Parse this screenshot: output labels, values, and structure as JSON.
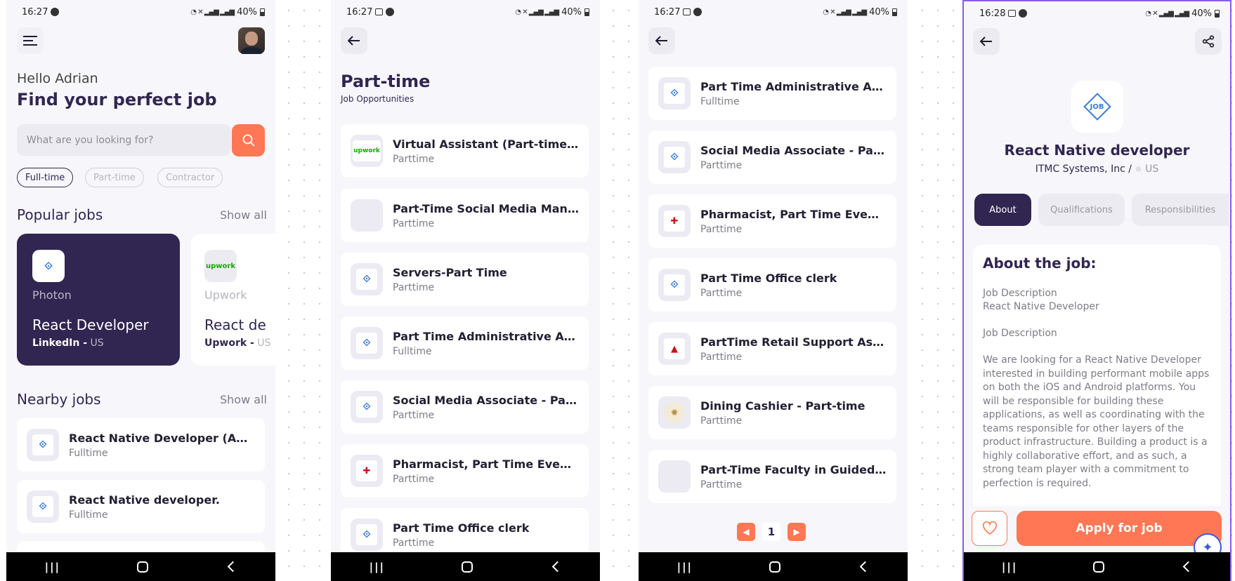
{
  "status": {
    "time_1": "16:27",
    "time_2": "16:27",
    "time_3": "16:27",
    "time_4": "16:28",
    "battery": "40%",
    "network": "VoB LTE"
  },
  "home": {
    "greeting": "Hello Adrian",
    "headline": "Find your perfect job",
    "search_placeholder": "What are you looking for?",
    "chips": [
      "Full-time",
      "Part-time",
      "Contractor"
    ],
    "popular_title": "Popular jobs",
    "show_all": "Show all",
    "popular": [
      {
        "company": "Photon",
        "title": "React Developer",
        "source": "LinkedIn -",
        "location": "US"
      },
      {
        "company": "Upwork",
        "title": "React de",
        "source": "Upwork -",
        "location": "US",
        "logo_text": "upwork"
      }
    ],
    "nearby_title": "Nearby jobs",
    "nearby": [
      {
        "title": "React Native Developer (And...",
        "type": "Fulltime"
      },
      {
        "title": "React Native developer.",
        "type": "Fulltime"
      }
    ]
  },
  "parttime": {
    "title": "Part-time",
    "subtitle": "Job Opportunities",
    "jobs": [
      {
        "title": "Virtual Assistant (Part-time)...",
        "type": "Parttime",
        "logo": "upwork"
      },
      {
        "title": "Part-Time Social Media Mana...",
        "type": "Parttime",
        "logo": "empty"
      },
      {
        "title": "Servers-Part Time",
        "type": "Parttime",
        "logo": "job"
      },
      {
        "title": "Part Time Administrative Ass...",
        "type": "Fulltime",
        "logo": "job"
      },
      {
        "title": "Social Media Associate - Part...",
        "type": "Parttime",
        "logo": "job"
      },
      {
        "title": "Pharmacist, Part Time Evening",
        "type": "Parttime",
        "logo": "red"
      },
      {
        "title": "Part Time Office clerk",
        "type": "Parttime",
        "logo": "job"
      }
    ]
  },
  "scrolled": {
    "jobs": [
      {
        "title": "Part Time Administrative Ass...",
        "type": "Fulltime",
        "logo": "job"
      },
      {
        "title": "Social Media Associate - Part...",
        "type": "Parttime",
        "logo": "job"
      },
      {
        "title": "Pharmacist, Part Time Evening",
        "type": "Parttime",
        "logo": "red"
      },
      {
        "title": "Part Time Office clerk",
        "type": "Parttime",
        "logo": "job"
      },
      {
        "title": "PartTime Retail Support Asso...",
        "type": "Parttime",
        "logo": "red"
      },
      {
        "title": "Dining Cashier - Part-time",
        "type": "Parttime",
        "logo": "seal"
      },
      {
        "title": "Part-Time Faculty in GuidedP...",
        "type": "Parttime",
        "logo": "empty"
      }
    ],
    "page": "1"
  },
  "detail": {
    "logo_text": "JOB",
    "title": "React Native developer",
    "company": "ITMC Systems, Inc /",
    "location": "US",
    "tabs": [
      "About",
      "Qualifications",
      "Responsibilities"
    ],
    "about_heading": "About the job:",
    "desc_line1": "Job Description",
    "desc_line2": "React Native Developer",
    "desc_line3": "Job Description",
    "desc_body": "We are looking for a React Native Developer interested in building performant mobile apps on both the iOS and Android platforms. You will be responsible for building these applications, as well as coordinating with the teams responsible for other layers of the product infrastructure. Building a product is a highly collaborative effort, and as such, a strong team player with a commitment to perfection is required.",
    "apply_label": "Apply for job"
  },
  "colors": {
    "accent": "#ff7754",
    "primary": "#312651",
    "background": "#f7f6fb"
  }
}
